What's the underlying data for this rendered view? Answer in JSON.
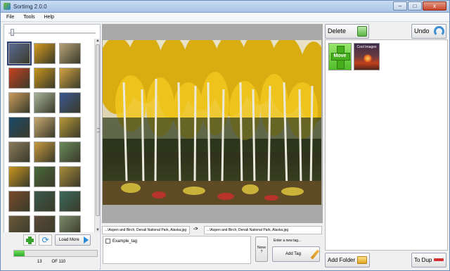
{
  "window": {
    "title": "Sortimg 2.0.0",
    "controls": [
      "–",
      "□",
      "x"
    ]
  },
  "menu": [
    "File",
    "Tools",
    "Help"
  ],
  "thumbnails": {
    "selected_index": 0,
    "colors": [
      "#5b6a92",
      "#d49a1e",
      "#b8a277",
      "#c84020",
      "#c8961c",
      "#d4a440",
      "#c89c5c",
      "#a8b49a",
      "#3a5890",
      "#1a4a6a",
      "#c8a870",
      "#b89838",
      "#8a7a5c",
      "#c89a40",
      "#6a8a5a",
      "#c8961c",
      "#4a6a3a",
      "#a88a3a",
      "#7a4a2a",
      "#3a5a4a",
      "#3a6a5a",
      "#6a5a3a",
      "#5a4a3a",
      "#7a8a6a"
    ]
  },
  "left_bottom": {
    "load_more_label": "Load More",
    "progress_percent": 13,
    "current": "13",
    "of_label": "OF 110"
  },
  "preview": {
    "source_path": "...\\Aspen and Birch, Denali National Park, Alaska.jpg",
    "arrow": "->",
    "dest_path": "...\\Aspen and Birch, Denali National Park, Alaska.jpg"
  },
  "tags": {
    "items": [
      {
        "label": "Example_tag",
        "checked": false
      }
    ],
    "none_label": "None",
    "none_sub": "?",
    "new_tag_label": "Enter a new tag...",
    "add_tag_label": "Add Tag"
  },
  "right_panel": {
    "delete_label": "Delete",
    "undo_label": "Undo",
    "folders": [
      {
        "label": "Move"
      },
      {
        "label": "Cool Images"
      }
    ],
    "add_folder_label": "Add Folder",
    "to_dup_label": "To Dup"
  },
  "colors": {
    "accent_green": "#3aa12f",
    "accent_blue": "#2c8ad4",
    "title_bar": "#a9c4e6"
  }
}
